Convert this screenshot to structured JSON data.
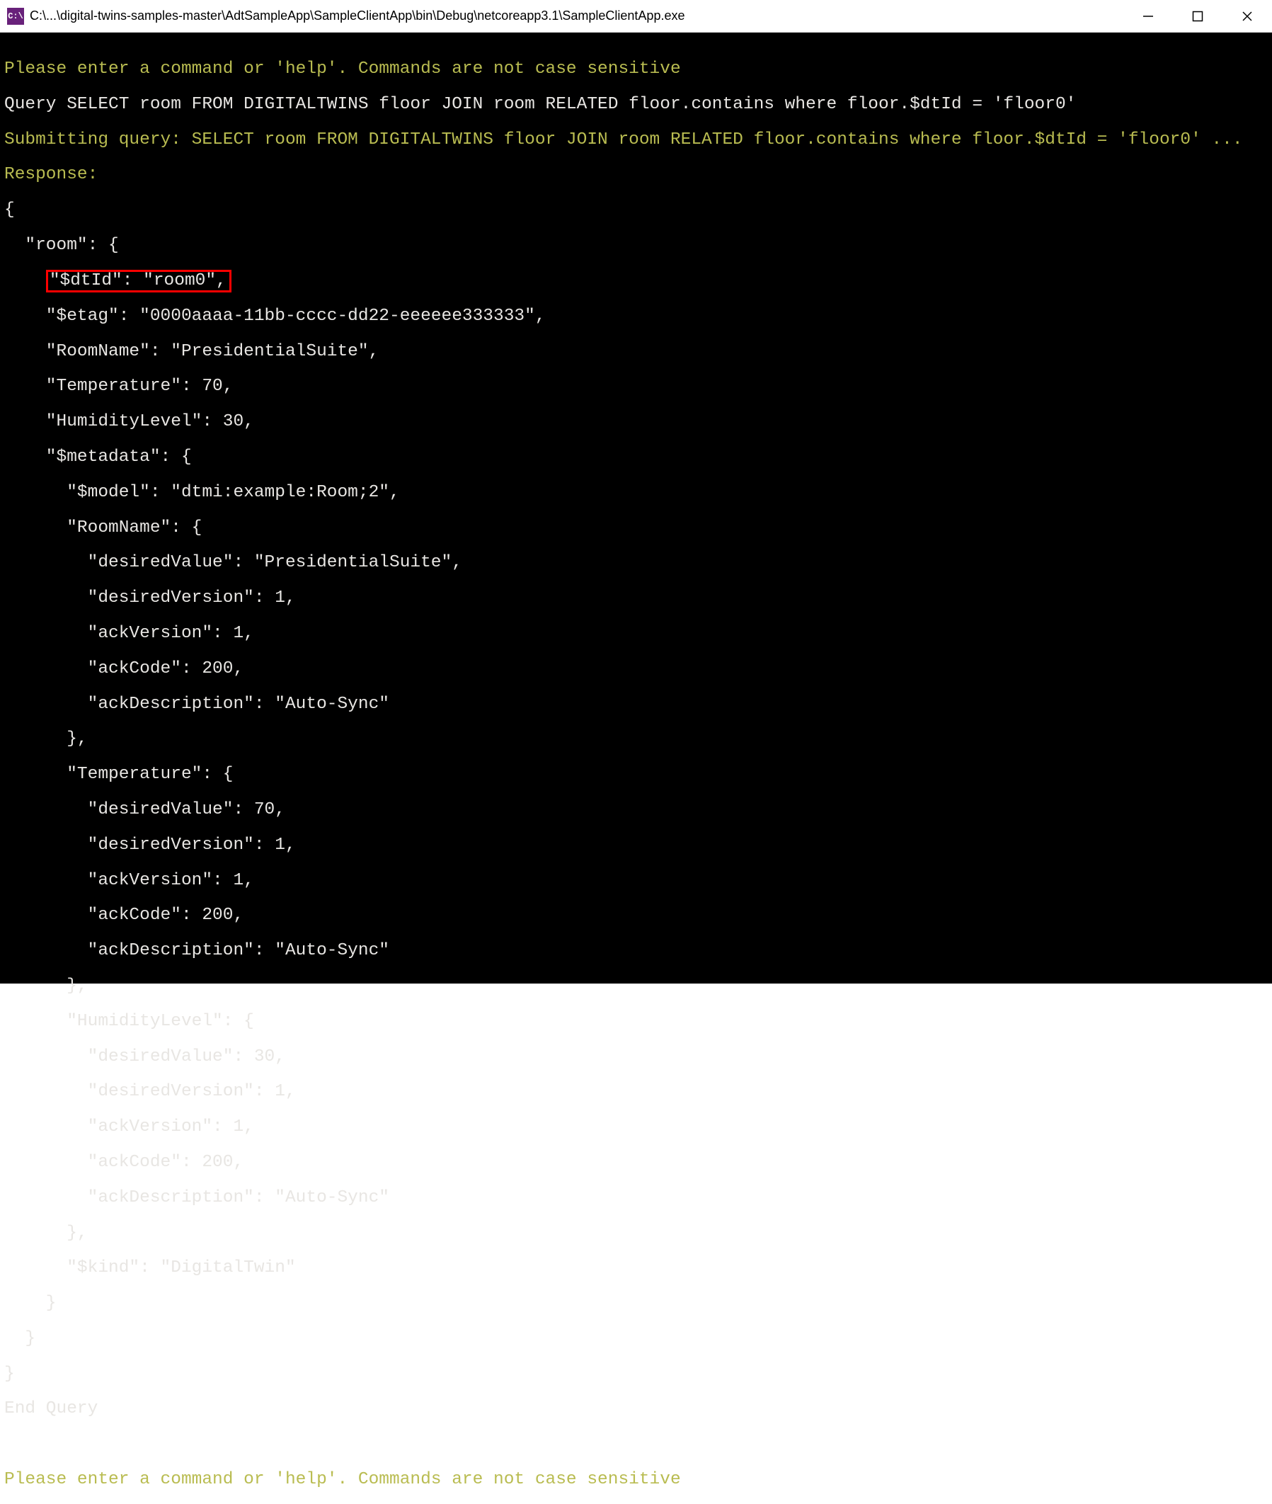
{
  "window": {
    "icon_label": "C:\\",
    "title": "C:\\...\\digital-twins-samples-master\\AdtSampleApp\\SampleClientApp\\bin\\Debug\\netcoreapp3.1\\SampleClientApp.exe"
  },
  "prompt": {
    "help1": "Please enter a command or 'help'. Commands are not case sensitive",
    "query_echo": "Query SELECT room FROM DIGITALTWINS floor JOIN room RELATED floor.contains where floor.$dtId = 'floor0'",
    "submitting": "Submitting query: SELECT room FROM DIGITALTWINS floor JOIN room RELATED floor.contains where floor.$dtId = 'floor0' ...",
    "response": "Response:",
    "end": "End Query",
    "help2": "Please enter a command or 'help'. Commands are not case sensitive"
  },
  "json_lines": {
    "l0": "{",
    "l1": "  \"room\": {",
    "hl_indent": "    ",
    "hl_text": "\"$dtId\": \"room0\",",
    "l3": "    \"$etag\": \"0000aaaa-11bb-cccc-dd22-eeeeee333333\",",
    "l4": "    \"RoomName\": \"PresidentialSuite\",",
    "l5": "    \"Temperature\": 70,",
    "l6": "    \"HumidityLevel\": 30,",
    "l7": "    \"$metadata\": {",
    "l8": "      \"$model\": \"dtmi:example:Room;2\",",
    "l9": "      \"RoomName\": {",
    "l10": "        \"desiredValue\": \"PresidentialSuite\",",
    "l11": "        \"desiredVersion\": 1,",
    "l12": "        \"ackVersion\": 1,",
    "l13": "        \"ackCode\": 200,",
    "l14": "        \"ackDescription\": \"Auto-Sync\"",
    "l15": "      },",
    "l16": "      \"Temperature\": {",
    "l17": "        \"desiredValue\": 70,",
    "l18": "        \"desiredVersion\": 1,",
    "l19": "        \"ackVersion\": 1,",
    "l20": "        \"ackCode\": 200,",
    "l21": "        \"ackDescription\": \"Auto-Sync\"",
    "l22": "      },",
    "l23": "      \"HumidityLevel\": {",
    "l24": "        \"desiredValue\": 30,",
    "l25": "        \"desiredVersion\": 1,",
    "l26": "        \"ackVersion\": 1,",
    "l27": "        \"ackCode\": 200,",
    "l28": "        \"ackDescription\": \"Auto-Sync\"",
    "l29": "      },",
    "l30": "      \"$kind\": \"DigitalTwin\"",
    "l31": "    }",
    "l32": "  }",
    "l33": "}"
  },
  "response_data": {
    "room": {
      "$dtId": "room0",
      "$etag": "0000aaaa-11bb-cccc-dd22-eeeeee333333",
      "RoomName": "PresidentialSuite",
      "Temperature": 70,
      "HumidityLevel": 30,
      "$metadata": {
        "$model": "dtmi:example:Room;2",
        "RoomName": {
          "desiredValue": "PresidentialSuite",
          "desiredVersion": 1,
          "ackVersion": 1,
          "ackCode": 200,
          "ackDescription": "Auto-Sync"
        },
        "Temperature": {
          "desiredValue": 70,
          "desiredVersion": 1,
          "ackVersion": 1,
          "ackCode": 200,
          "ackDescription": "Auto-Sync"
        },
        "HumidityLevel": {
          "desiredValue": 30,
          "desiredVersion": 1,
          "ackVersion": 1,
          "ackCode": 200,
          "ackDescription": "Auto-Sync"
        },
        "$kind": "DigitalTwin"
      }
    }
  }
}
